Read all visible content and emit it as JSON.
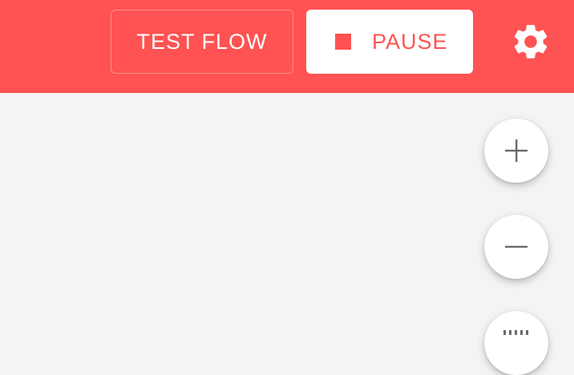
{
  "toolbar": {
    "test_flow_label": "TEST FLOW",
    "pause_label": "PAUSE",
    "accent_color": "#ff5252"
  },
  "icons": {
    "stop": "stop-icon",
    "settings": "gear-icon",
    "zoom_in": "plus-icon",
    "zoom_out": "minus-icon",
    "fit": "grid-icon"
  }
}
